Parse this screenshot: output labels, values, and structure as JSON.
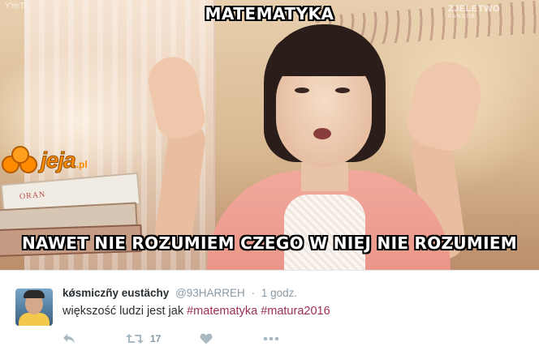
{
  "meme": {
    "title": "MATEMATYKA",
    "caption": "NAWET NIE ROZUMIEM CZEGO W NIEJ NIE ROZUMIEM",
    "watermark_tl": "YYeTs",
    "watermark_tr": "ZJELETWO",
    "watermark_tr_sub": "FANSUB",
    "logo_text": "jeja",
    "logo_tld": ".pl",
    "book_text": "ORAN"
  },
  "tweet": {
    "display_name": "kǿsmiczñy eustächy",
    "handle": "@93HARREH",
    "separator": "·",
    "time": "1 godz.",
    "text_prefix": "większość ludzi jest jak ",
    "hashtags": [
      "#matematyka",
      "#matura2016"
    ],
    "retweet_count": "17",
    "colors": {
      "name": "#292f33",
      "muted": "#8899a6",
      "hashtag": "#9a2e5b",
      "icon": "#aab8c2"
    },
    "actions": [
      "reply-icon",
      "retweet-icon",
      "like-icon",
      "more-icon"
    ]
  }
}
